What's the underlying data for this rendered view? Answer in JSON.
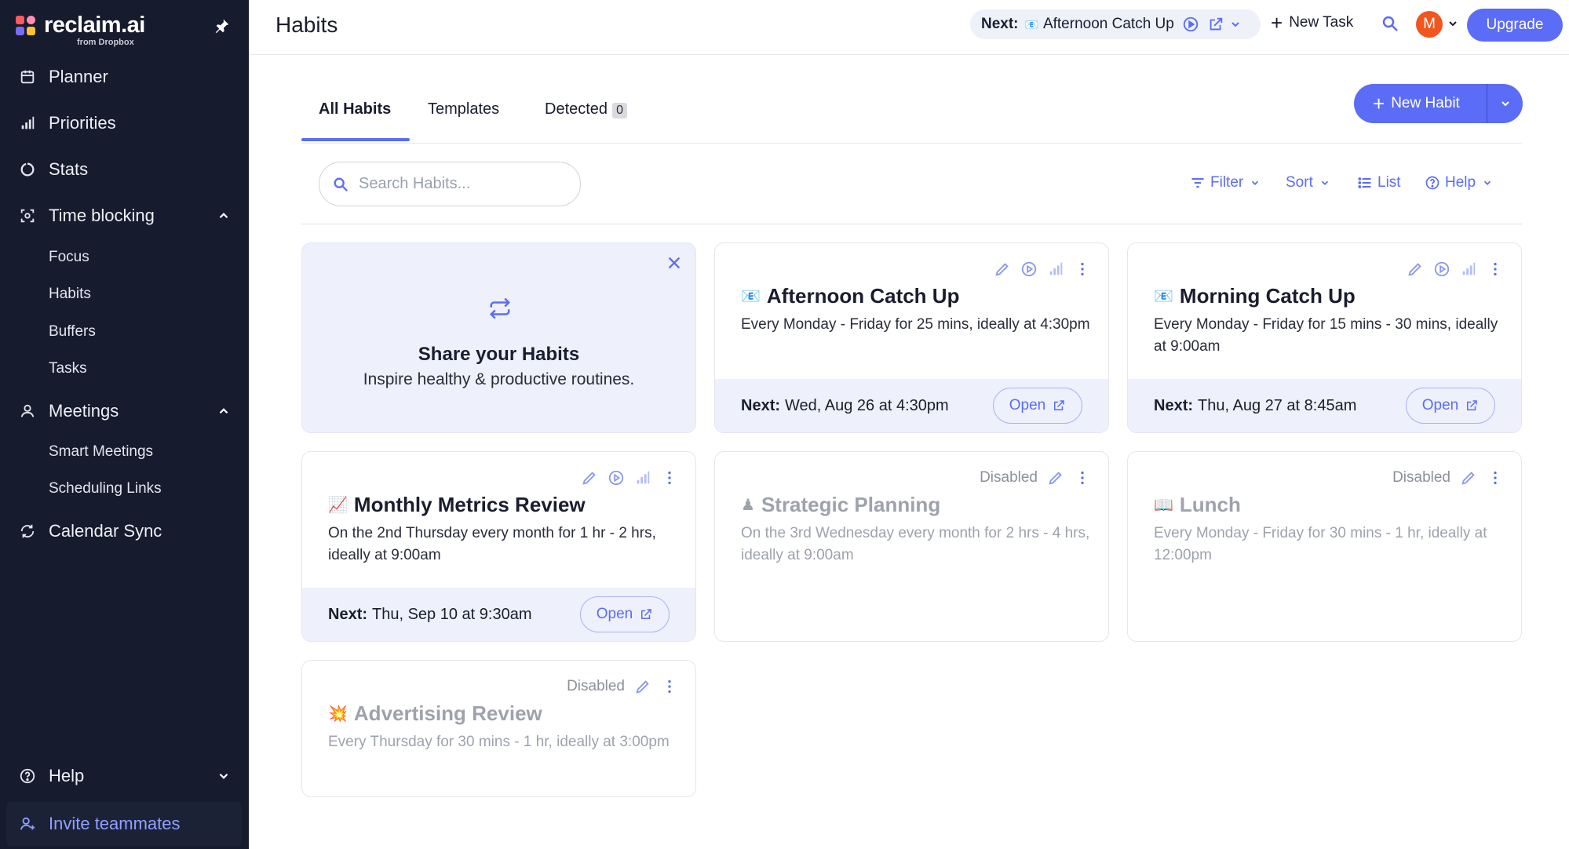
{
  "sidebar": {
    "logo_text": "reclaim.ai",
    "logo_sub": "from Dropbox",
    "nav": {
      "planner": "Planner",
      "priorities": "Priorities",
      "stats": "Stats",
      "time_blocking": "Time blocking",
      "meetings": "Meetings",
      "calendar_sync": "Calendar Sync",
      "help": "Help"
    },
    "time_blocking_items": [
      "Focus",
      "Habits",
      "Buffers",
      "Tasks"
    ],
    "meetings_items": [
      "Smart Meetings",
      "Scheduling Links"
    ],
    "invite": "Invite teammates"
  },
  "topbar": {
    "title": "Habits",
    "next_label": "Next:",
    "next_value": "Afternoon Catch Up",
    "new_task": "New Task",
    "avatar_initial": "M",
    "upgrade": "Upgrade"
  },
  "tabs": {
    "all": "All Habits",
    "templates": "Templates",
    "detected": "Detected",
    "detected_count": "0"
  },
  "new_habit": "New Habit",
  "search": {
    "placeholder": "Search Habits..."
  },
  "toolbar": {
    "filter": "Filter",
    "sort": "Sort",
    "list": "List",
    "help": "Help"
  },
  "share_card": {
    "title": "Share your Habits",
    "subtitle": "Inspire healthy & productive routines."
  },
  "cards": [
    {
      "emoji": "📧",
      "title": "Afternoon Catch Up",
      "desc": "Every Monday - Friday for 25 mins, ideally at 4:30pm",
      "next_label": "Next:",
      "next_value": "Wed, Aug 26 at 4:30pm",
      "open": "Open"
    },
    {
      "emoji": "📧",
      "title": "Morning Catch Up",
      "desc": "Every Monday - Friday for 15 mins - 30 mins, ideally at 9:00am",
      "next_label": "Next:",
      "next_value": "Thu, Aug 27 at 8:45am",
      "open": "Open"
    },
    {
      "emoji": "📈",
      "title": "Monthly Metrics Review",
      "desc": "On the 2nd Thursday every month for 1 hr - 2 hrs, ideally at 9:00am",
      "next_label": "Next:",
      "next_value": "Thu, Sep 10 at 9:30am",
      "open": "Open"
    },
    {
      "emoji": "♟",
      "title": "Strategic Planning",
      "desc": "On the 3rd Wednesday every month for 2 hrs - 4 hrs, ideally at 9:00am",
      "status": "Disabled"
    },
    {
      "emoji": "📖",
      "title": "Lunch",
      "desc": "Every Monday - Friday for 30 mins - 1 hr, ideally at 12:00pm",
      "status": "Disabled"
    },
    {
      "emoji": "💥",
      "title": "Advertising Review",
      "desc": "Every Thursday for 30 mins - 1 hr, ideally at 3:00pm",
      "status": "Disabled"
    }
  ],
  "colors": {
    "sidebar_bg": "#161b2d",
    "accent": "#5b6cf6",
    "card_footer_bg": "#eef0fb",
    "avatar_bg": "#f2551e"
  }
}
